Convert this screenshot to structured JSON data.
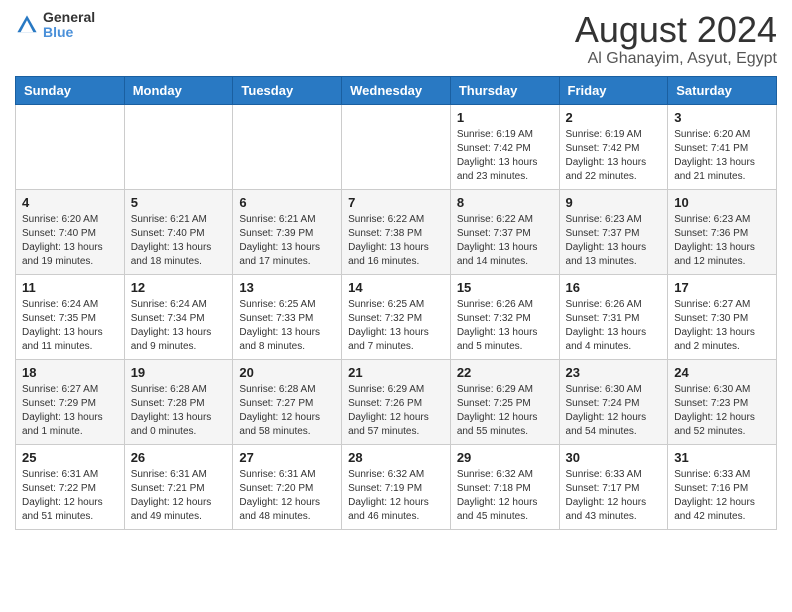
{
  "header": {
    "logo_line1": "General",
    "logo_line2": "Blue",
    "month_title": "August 2024",
    "location": "Al Ghanayim, Asyut, Egypt"
  },
  "days_of_week": [
    "Sunday",
    "Monday",
    "Tuesday",
    "Wednesday",
    "Thursday",
    "Friday",
    "Saturday"
  ],
  "weeks": [
    [
      {
        "day": "",
        "info": ""
      },
      {
        "day": "",
        "info": ""
      },
      {
        "day": "",
        "info": ""
      },
      {
        "day": "",
        "info": ""
      },
      {
        "day": "1",
        "info": "Sunrise: 6:19 AM\nSunset: 7:42 PM\nDaylight: 13 hours and 23 minutes."
      },
      {
        "day": "2",
        "info": "Sunrise: 6:19 AM\nSunset: 7:42 PM\nDaylight: 13 hours and 22 minutes."
      },
      {
        "day": "3",
        "info": "Sunrise: 6:20 AM\nSunset: 7:41 PM\nDaylight: 13 hours and 21 minutes."
      }
    ],
    [
      {
        "day": "4",
        "info": "Sunrise: 6:20 AM\nSunset: 7:40 PM\nDaylight: 13 hours and 19 minutes."
      },
      {
        "day": "5",
        "info": "Sunrise: 6:21 AM\nSunset: 7:40 PM\nDaylight: 13 hours and 18 minutes."
      },
      {
        "day": "6",
        "info": "Sunrise: 6:21 AM\nSunset: 7:39 PM\nDaylight: 13 hours and 17 minutes."
      },
      {
        "day": "7",
        "info": "Sunrise: 6:22 AM\nSunset: 7:38 PM\nDaylight: 13 hours and 16 minutes."
      },
      {
        "day": "8",
        "info": "Sunrise: 6:22 AM\nSunset: 7:37 PM\nDaylight: 13 hours and 14 minutes."
      },
      {
        "day": "9",
        "info": "Sunrise: 6:23 AM\nSunset: 7:37 PM\nDaylight: 13 hours and 13 minutes."
      },
      {
        "day": "10",
        "info": "Sunrise: 6:23 AM\nSunset: 7:36 PM\nDaylight: 13 hours and 12 minutes."
      }
    ],
    [
      {
        "day": "11",
        "info": "Sunrise: 6:24 AM\nSunset: 7:35 PM\nDaylight: 13 hours and 11 minutes."
      },
      {
        "day": "12",
        "info": "Sunrise: 6:24 AM\nSunset: 7:34 PM\nDaylight: 13 hours and 9 minutes."
      },
      {
        "day": "13",
        "info": "Sunrise: 6:25 AM\nSunset: 7:33 PM\nDaylight: 13 hours and 8 minutes."
      },
      {
        "day": "14",
        "info": "Sunrise: 6:25 AM\nSunset: 7:32 PM\nDaylight: 13 hours and 7 minutes."
      },
      {
        "day": "15",
        "info": "Sunrise: 6:26 AM\nSunset: 7:32 PM\nDaylight: 13 hours and 5 minutes."
      },
      {
        "day": "16",
        "info": "Sunrise: 6:26 AM\nSunset: 7:31 PM\nDaylight: 13 hours and 4 minutes."
      },
      {
        "day": "17",
        "info": "Sunrise: 6:27 AM\nSunset: 7:30 PM\nDaylight: 13 hours and 2 minutes."
      }
    ],
    [
      {
        "day": "18",
        "info": "Sunrise: 6:27 AM\nSunset: 7:29 PM\nDaylight: 13 hours and 1 minute."
      },
      {
        "day": "19",
        "info": "Sunrise: 6:28 AM\nSunset: 7:28 PM\nDaylight: 13 hours and 0 minutes."
      },
      {
        "day": "20",
        "info": "Sunrise: 6:28 AM\nSunset: 7:27 PM\nDaylight: 12 hours and 58 minutes."
      },
      {
        "day": "21",
        "info": "Sunrise: 6:29 AM\nSunset: 7:26 PM\nDaylight: 12 hours and 57 minutes."
      },
      {
        "day": "22",
        "info": "Sunrise: 6:29 AM\nSunset: 7:25 PM\nDaylight: 12 hours and 55 minutes."
      },
      {
        "day": "23",
        "info": "Sunrise: 6:30 AM\nSunset: 7:24 PM\nDaylight: 12 hours and 54 minutes."
      },
      {
        "day": "24",
        "info": "Sunrise: 6:30 AM\nSunset: 7:23 PM\nDaylight: 12 hours and 52 minutes."
      }
    ],
    [
      {
        "day": "25",
        "info": "Sunrise: 6:31 AM\nSunset: 7:22 PM\nDaylight: 12 hours and 51 minutes."
      },
      {
        "day": "26",
        "info": "Sunrise: 6:31 AM\nSunset: 7:21 PM\nDaylight: 12 hours and 49 minutes."
      },
      {
        "day": "27",
        "info": "Sunrise: 6:31 AM\nSunset: 7:20 PM\nDaylight: 12 hours and 48 minutes."
      },
      {
        "day": "28",
        "info": "Sunrise: 6:32 AM\nSunset: 7:19 PM\nDaylight: 12 hours and 46 minutes."
      },
      {
        "day": "29",
        "info": "Sunrise: 6:32 AM\nSunset: 7:18 PM\nDaylight: 12 hours and 45 minutes."
      },
      {
        "day": "30",
        "info": "Sunrise: 6:33 AM\nSunset: 7:17 PM\nDaylight: 12 hours and 43 minutes."
      },
      {
        "day": "31",
        "info": "Sunrise: 6:33 AM\nSunset: 7:16 PM\nDaylight: 12 hours and 42 minutes."
      }
    ]
  ]
}
